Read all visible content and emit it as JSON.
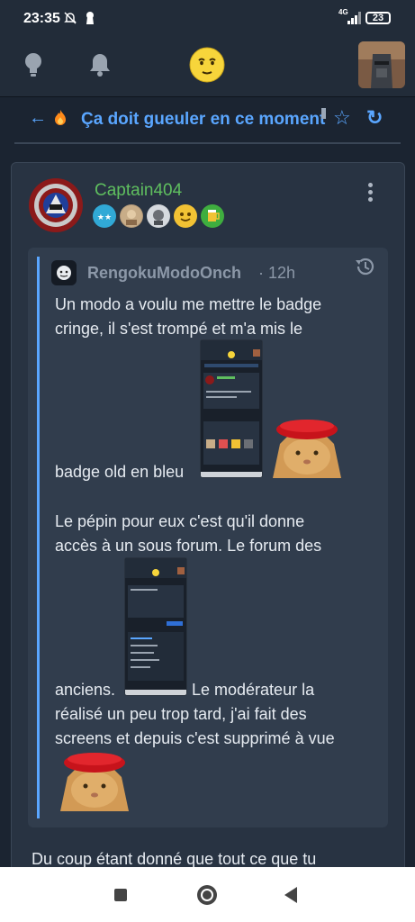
{
  "status_bar": {
    "time": "23:35",
    "network": "4G",
    "battery": "23"
  },
  "thread": {
    "title": "Ça doit gueuler en ce moment"
  },
  "post": {
    "author": "Captain404",
    "quote": {
      "author": "RengokuModoOnch",
      "time": "· 12h",
      "lines": [
        "Un modo a voulu me mettre le badge",
        "cringe, il s'est trompé et m'a mis le",
        "badge old en bleu",
        "Le pépin pour eux c'est qu'il donne",
        "accès à un sous forum. Le forum des",
        "anciens.",
        "Le modérateur la",
        "réalisé un peu trop tard, j'ai fait des",
        "screens et depuis c'est supprimé à vue"
      ]
    },
    "body_start": "Du coup étant donné que tout ce que tu"
  },
  "colors": {
    "background": "#1b2431",
    "accent": "#5aa6ff",
    "username": "#5fbf5f",
    "quote_bg": "#313d4d"
  },
  "icons": {
    "top_left": "lightbulb-icon",
    "notifications": "bell-icon",
    "logo": "smiley-logo-icon",
    "back": "arrow-left-icon",
    "hot": "fire-icon",
    "favorite": "star-outline-icon",
    "refresh": "refresh-icon",
    "menu": "kebab-menu-icon",
    "history": "history-icon"
  }
}
